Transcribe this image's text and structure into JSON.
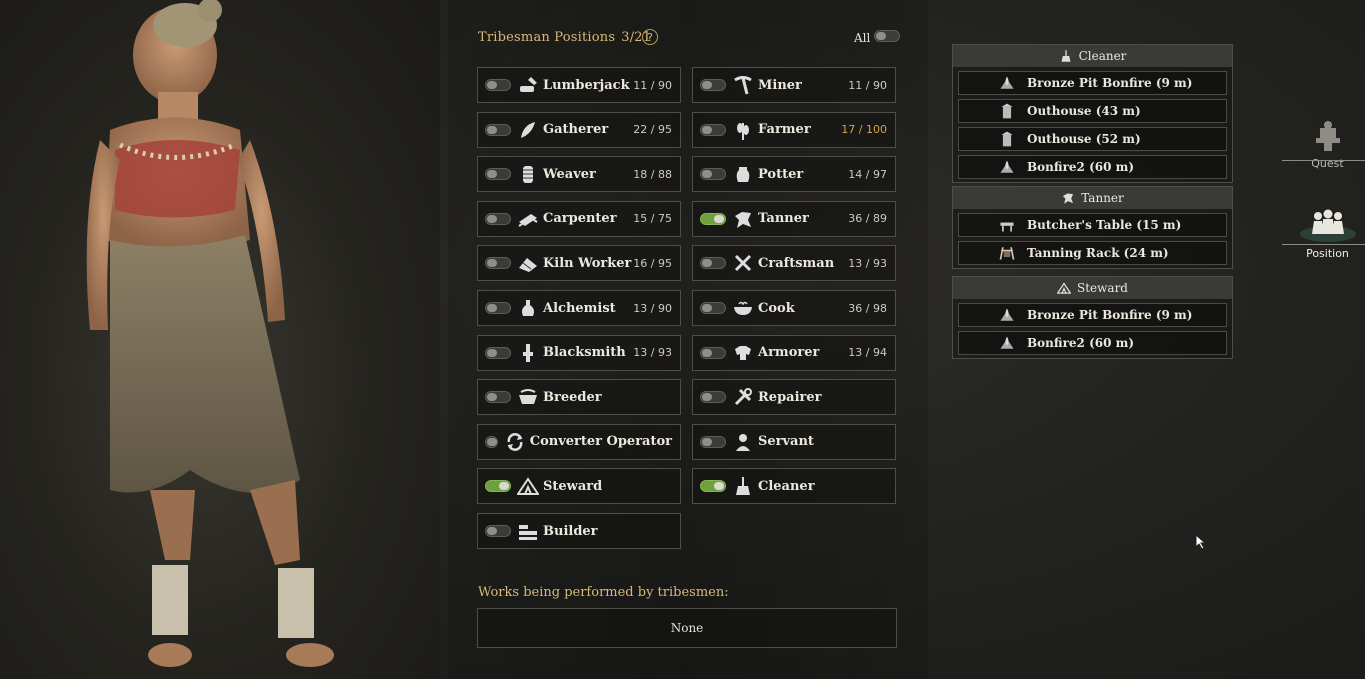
{
  "header": {
    "title": "Tribesman Positions",
    "count": "3/21",
    "help": "?",
    "all_label": "All"
  },
  "positions": [
    {
      "label": "Lumberjack",
      "count": "11 / 90",
      "on": false,
      "icon": "axe-log-icon"
    },
    {
      "label": "Miner",
      "count": "11 / 90",
      "on": false,
      "icon": "pickaxe-icon"
    },
    {
      "label": "Gatherer",
      "count": "22 / 95",
      "on": false,
      "icon": "leaf-icon"
    },
    {
      "label": "Farmer",
      "count": "17 / 100",
      "on": false,
      "icon": "wheat-icon",
      "warn": true
    },
    {
      "label": "Weaver",
      "count": "18 / 88",
      "on": false,
      "icon": "spindle-icon"
    },
    {
      "label": "Potter",
      "count": "14 / 97",
      "on": false,
      "icon": "pot-icon"
    },
    {
      "label": "Carpenter",
      "count": "15 / 75",
      "on": false,
      "icon": "planks-icon"
    },
    {
      "label": "Tanner",
      "count": "36 / 89",
      "on": true,
      "icon": "hide-icon"
    },
    {
      "label": "Kiln Worker",
      "count": "16 / 95",
      "on": false,
      "icon": "bricks-icon"
    },
    {
      "label": "Craftsman",
      "count": "13 / 93",
      "on": false,
      "icon": "crossed-tools-icon"
    },
    {
      "label": "Alchemist",
      "count": "13 / 90",
      "on": false,
      "icon": "flask-icon"
    },
    {
      "label": "Cook",
      "count": "36 / 98",
      "on": false,
      "icon": "bowl-icon"
    },
    {
      "label": "Blacksmith",
      "count": "13 / 93",
      "on": false,
      "icon": "anvil-icon"
    },
    {
      "label": "Armorer",
      "count": "13 / 94",
      "on": false,
      "icon": "armor-icon"
    },
    {
      "label": "Breeder",
      "count": "",
      "on": false,
      "icon": "trough-icon"
    },
    {
      "label": "Repairer",
      "count": "",
      "on": false,
      "icon": "wrench-icon"
    },
    {
      "label": "Converter Operator",
      "count": "",
      "on": false,
      "icon": "cycle-icon"
    },
    {
      "label": "Servant",
      "count": "",
      "on": false,
      "icon": "servant-icon"
    },
    {
      "label": "Steward",
      "count": "",
      "on": true,
      "icon": "tent-icon"
    },
    {
      "label": "Cleaner",
      "count": "",
      "on": true,
      "icon": "broom-icon"
    },
    {
      "label": "Builder",
      "count": "",
      "on": false,
      "icon": "bricks-stack-icon"
    }
  ],
  "works": {
    "label": "Works being performed by tribesmen:",
    "value": "None"
  },
  "groups": [
    {
      "title": "Cleaner",
      "icon": "broom-icon",
      "items": [
        {
          "label": "Bronze Pit Bonfire (9 m)",
          "icon": "bonfire-icon"
        },
        {
          "label": "Outhouse (43 m)",
          "icon": "outhouse-icon"
        },
        {
          "label": "Outhouse (52 m)",
          "icon": "outhouse-icon"
        },
        {
          "label": "Bonfire2 (60 m)",
          "icon": "bonfire-icon"
        }
      ]
    },
    {
      "title": "Tanner",
      "icon": "hide-icon",
      "items": [
        {
          "label": "Butcher's Table (15 m)",
          "icon": "table-icon"
        },
        {
          "label": "Tanning Rack (24 m)",
          "icon": "rack-icon"
        }
      ]
    },
    {
      "title": "Steward",
      "icon": "tent-icon",
      "items": [
        {
          "label": "Bronze Pit Bonfire (9 m)",
          "icon": "bonfire-icon"
        },
        {
          "label": "Bonfire2 (60 m)",
          "icon": "bonfire-icon"
        }
      ]
    }
  ],
  "side": {
    "quest": "Quest",
    "position": "Position"
  }
}
